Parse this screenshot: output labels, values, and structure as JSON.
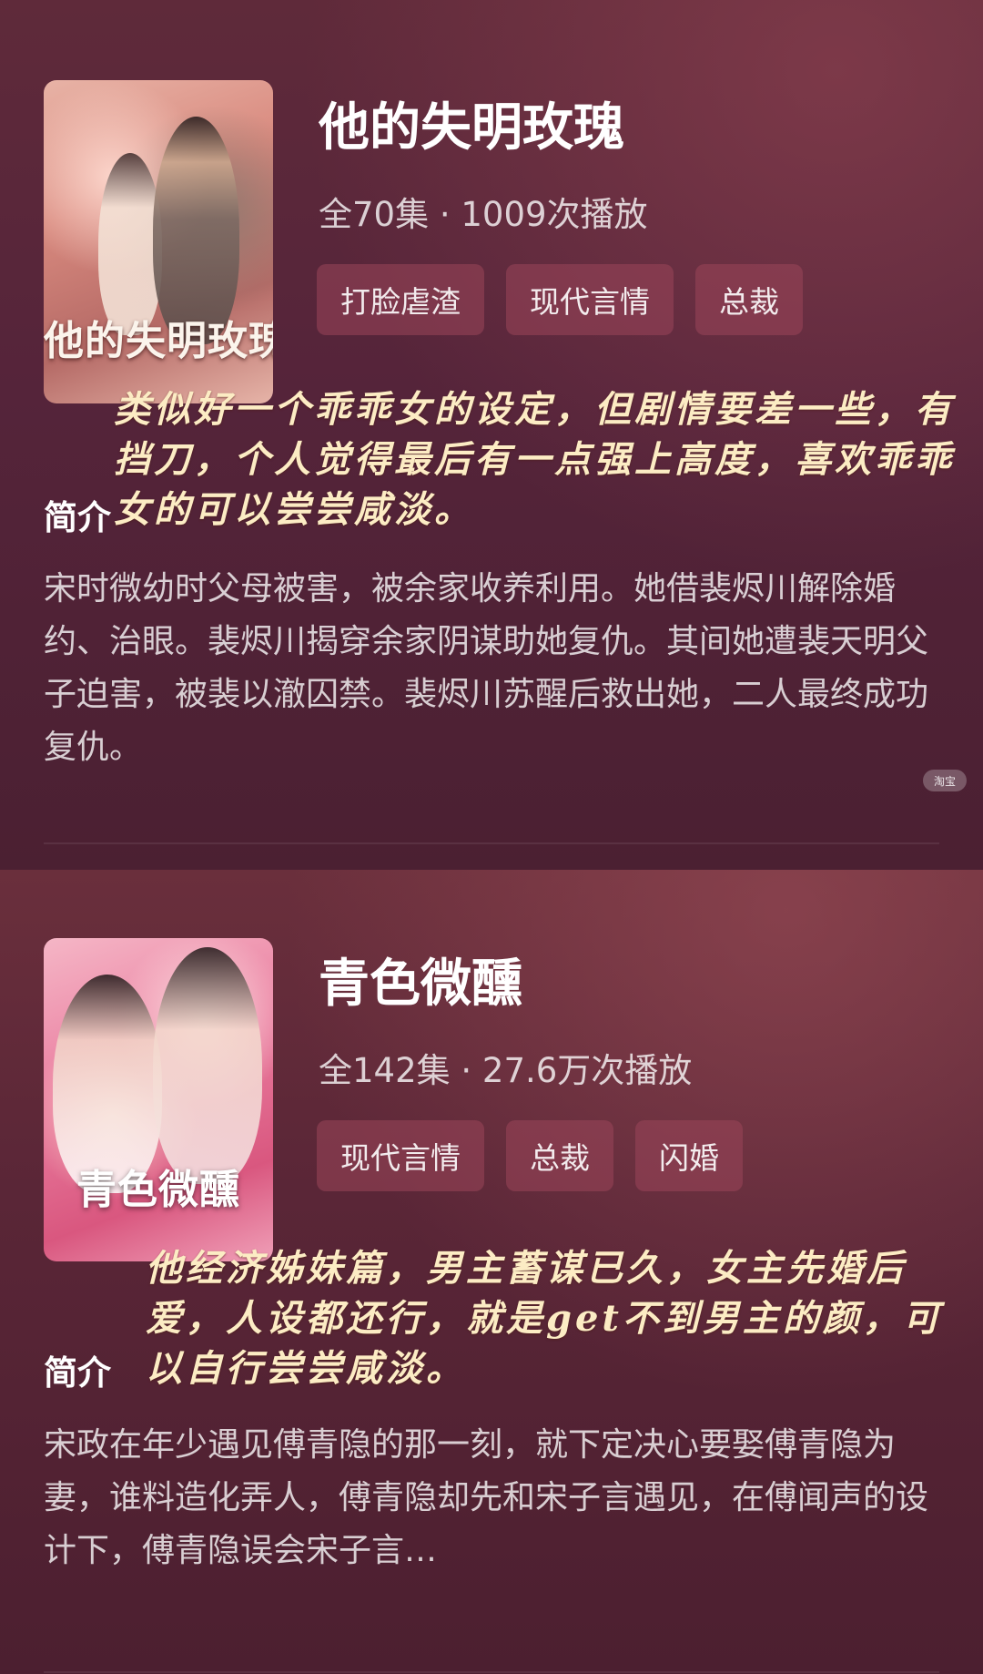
{
  "dramas": [
    {
      "title": "他的失明玫瑰",
      "poster_title": "他的失明玫瑰",
      "meta": "全70集 · 1009次播放",
      "tags": [
        "打脸虐渣",
        "现代言情",
        "总裁"
      ],
      "handwritten_note": "类似好一个乖乖女的设定，但剧情要差一些，有挡刀，个人觉得最后有一点强上高度，喜欢乖乖女的可以尝尝咸淡。",
      "synopsis_label": "简介",
      "synopsis": "宋时微幼时父母被害，被余家收养利用。她借裴烬川解除婚约、治眼。裴烬川揭穿余家阴谋助她复仇。其间她遭裴天明父子迫害，被裴以澈囚禁。裴烬川苏醒后救出她，二人最终成功复仇。"
    },
    {
      "title": "青色微醺",
      "poster_title": "青色微醺",
      "meta": "全142集 · 27.6万次播放",
      "tags": [
        "现代言情",
        "总裁",
        "闪婚"
      ],
      "handwritten_note": "他经济姊妹篇，男主蓄谋已久，女主先婚后爱，人设都还行，就是get不到男主的颜，可以自行尝尝咸淡。",
      "synopsis_label": "简介",
      "synopsis": "宋政在年少遇见傅青隐的那一刻，就下定决心要娶傅青隐为妻，谁料造化弄人，傅青隐却先和宋子言遇见，在傅闻声的设计下，傅青隐误会宋子言…"
    }
  ],
  "watermark": "淘宝"
}
